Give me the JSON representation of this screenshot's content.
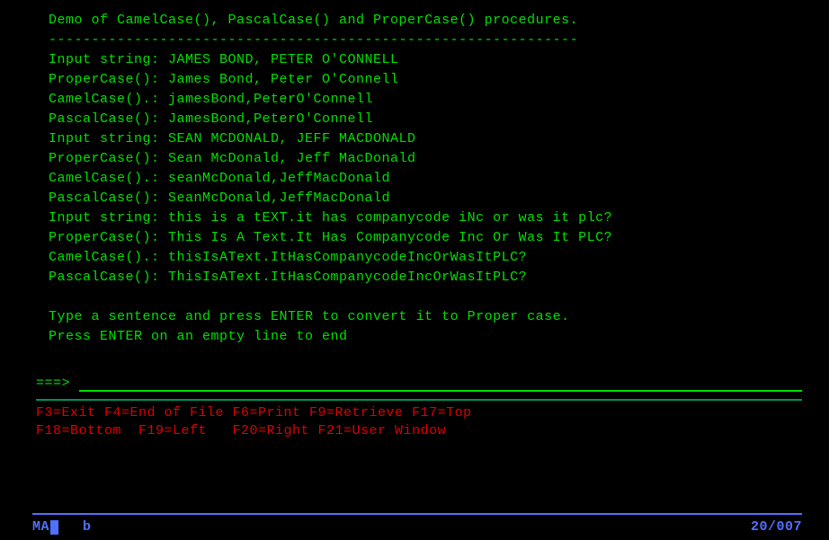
{
  "title": "Demo of CamelCase(), PascalCase() and ProperCase() procedures.",
  "divider": "--------------------------------------------------------------",
  "rows": [
    "Input string: JAMES BOND, PETER O'CONNELL",
    "ProperCase(): James Bond, Peter O'Connell",
    "CamelCase().: jamesBond,PeterO'Connell",
    "PascalCase(): JamesBond,PeterO'Connell",
    "Input string: SEAN MCDONALD, JEFF MACDONALD",
    "ProperCase(): Sean McDonald, Jeff MacDonald",
    "CamelCase().: seanMcDonald,JeffMacDonald",
    "PascalCase(): SeanMcDonald,JeffMacDonald",
    "Input string: this is a tEXT.it has companycode iNc or was it plc?",
    "ProperCase(): This Is A Text.It Has Companycode Inc Or Was It PLC?",
    "CamelCase().: thisIsAText.ItHasCompanycodeIncOrWasItPLC?",
    "PascalCase(): ThisIsAText.ItHasCompanycodeIncOrWasItPLC?"
  ],
  "instructions": [
    "Type a sentence and press ENTER to convert it to Proper case.",
    "Press ENTER on an empty line to end"
  ],
  "cmd": {
    "prompt": "===> ",
    "value": ""
  },
  "fkeys": [
    "F3=Exit F4=End of File F6=Print F9=Retrieve F17=Top",
    "F18=Bottom  F19=Left   F20=Right F21=User Window"
  ],
  "status": {
    "left": "MA",
    "indicator": "b",
    "position": "20/007"
  }
}
